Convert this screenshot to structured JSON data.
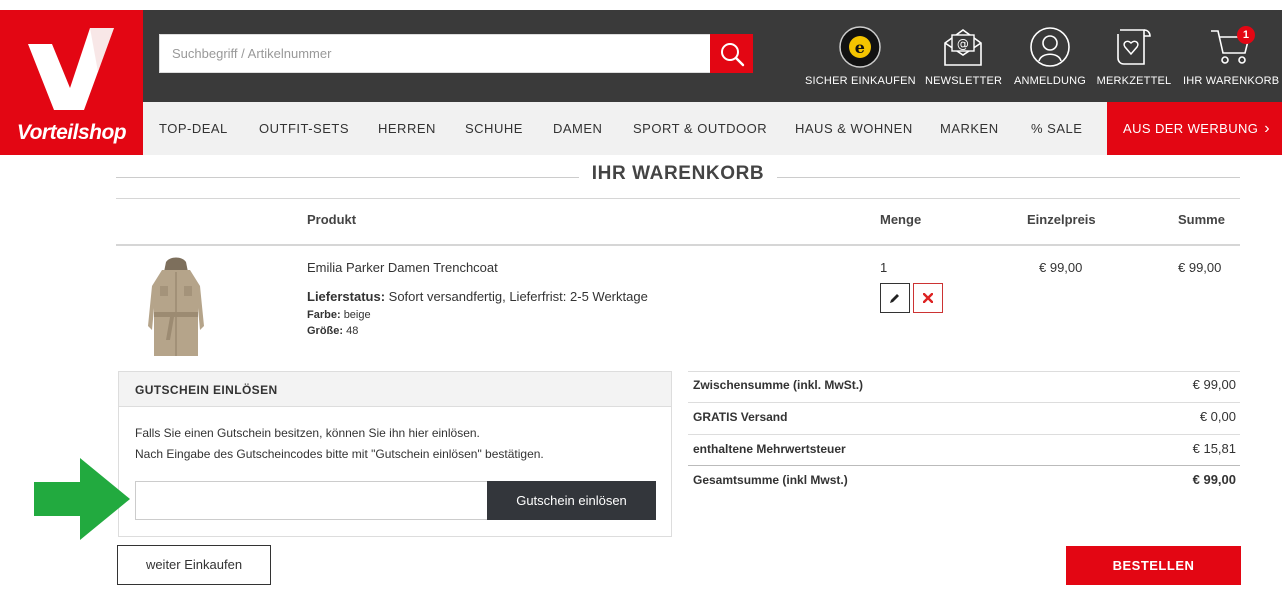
{
  "brand": {
    "logo_text": "Vorteilshop",
    "accent": "#e30613",
    "dark": "#3a3a3a"
  },
  "search": {
    "placeholder": "Suchbegriff / Artikelnummer",
    "icon": "search-icon"
  },
  "header_icons": [
    {
      "label": "SICHER EINKAUFEN",
      "icon": "trusted-shops-icon"
    },
    {
      "label": "NEWSLETTER",
      "icon": "newsletter-icon"
    },
    {
      "label": "ANMELDUNG",
      "icon": "user-icon"
    },
    {
      "label": "MERKZETTEL",
      "icon": "wishlist-icon"
    },
    {
      "label": "IHR WARENKORB",
      "icon": "cart-icon",
      "badge": "1"
    }
  ],
  "nav": {
    "items": [
      "TOP-DEAL",
      "OUTFIT-SETS",
      "HERREN",
      "SCHUHE",
      "DAMEN",
      "SPORT & OUTDOOR",
      "HAUS & WOHNEN",
      "MARKEN",
      "% SALE"
    ],
    "ad": "AUS DER WERBUNG"
  },
  "cart": {
    "title": "IHR WARENKORB",
    "columns": {
      "product": "Produkt",
      "quantity": "Menge",
      "unit_price": "Einzelpreis",
      "sum": "Summe"
    },
    "item": {
      "name": "Emilia Parker Damen Trenchcoat",
      "status_label": "Lieferstatus:",
      "status_value": "Sofort versandfertig, Lieferfrist: 2-5 Werktage",
      "color_label": "Farbe:",
      "color_value": "beige",
      "size_label": "Größe:",
      "size_value": "48",
      "quantity": "1",
      "unit_price": "€ 99,00",
      "sum": "€ 99,00"
    }
  },
  "voucher": {
    "heading": "GUTSCHEIN EINLÖSEN",
    "line1": "Falls Sie einen Gutschein besitzen, können Sie ihn hier einlösen.",
    "line2": "Nach Eingabe des Gutscheincodes bitte mit \"Gutschein einlösen\" bestätigen.",
    "input_value": "",
    "button": "Gutschein einlösen"
  },
  "totals": [
    {
      "label": "Zwischensumme (inkl. MwSt.)",
      "value": "€ 99,00"
    },
    {
      "label": "GRATIS Versand",
      "value": "€ 0,00"
    },
    {
      "label": "enthaltene Mehrwertsteuer",
      "value": "€ 15,81"
    },
    {
      "label": "Gesamtsumme (inkl Mwst.)",
      "value": "€ 99,00"
    }
  ],
  "buttons": {
    "continue": "weiter Einkaufen",
    "order": "BESTELLEN"
  }
}
